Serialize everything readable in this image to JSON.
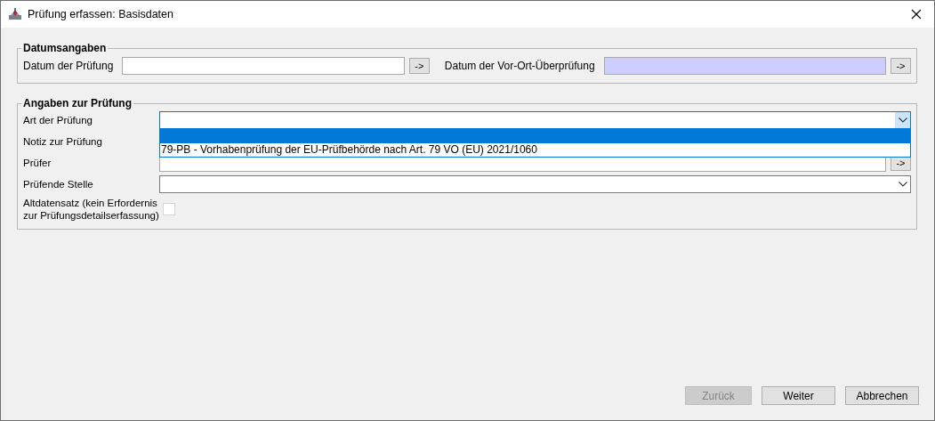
{
  "window": {
    "title": "Prüfung erfassen: Basisdaten"
  },
  "date_section": {
    "legend": "Datumsangaben",
    "fields": [
      {
        "label": "Datum der Prüfung",
        "button": "->",
        "highlighted": false
      },
      {
        "label": "Datum der Vor-Ort-Überprüfung",
        "button": "->",
        "highlighted": true
      }
    ]
  },
  "details_section": {
    "legend": "Angaben zur Prüfung",
    "rows": [
      {
        "kind": "combo",
        "label": "Art der Prüfung",
        "focused": true,
        "expanded": true,
        "blank_row_selected": true,
        "options": [
          {
            "label": "79-PB - Vorhabenprüfung der EU-Prüfbehörde nach Art. 79 VO (EU) 2021/1060",
            "selected": false
          }
        ]
      },
      {
        "kind": "covered",
        "label": "Notiz zur Prüfung"
      },
      {
        "kind": "text_button",
        "label": "Prüfer",
        "button": "->"
      },
      {
        "kind": "combo",
        "label": "Prüfende Stelle",
        "focused": false,
        "expanded": false
      },
      {
        "kind": "checkbox",
        "label": "Altdatensatz (kein Erfordernis\nzur Prüfungsdetailserfassung)",
        "checked": false
      }
    ]
  },
  "buttons": [
    {
      "label": "Zurück",
      "disabled": true
    },
    {
      "label": "Weiter",
      "disabled": false
    },
    {
      "label": "Abbrechen",
      "disabled": false
    }
  ]
}
